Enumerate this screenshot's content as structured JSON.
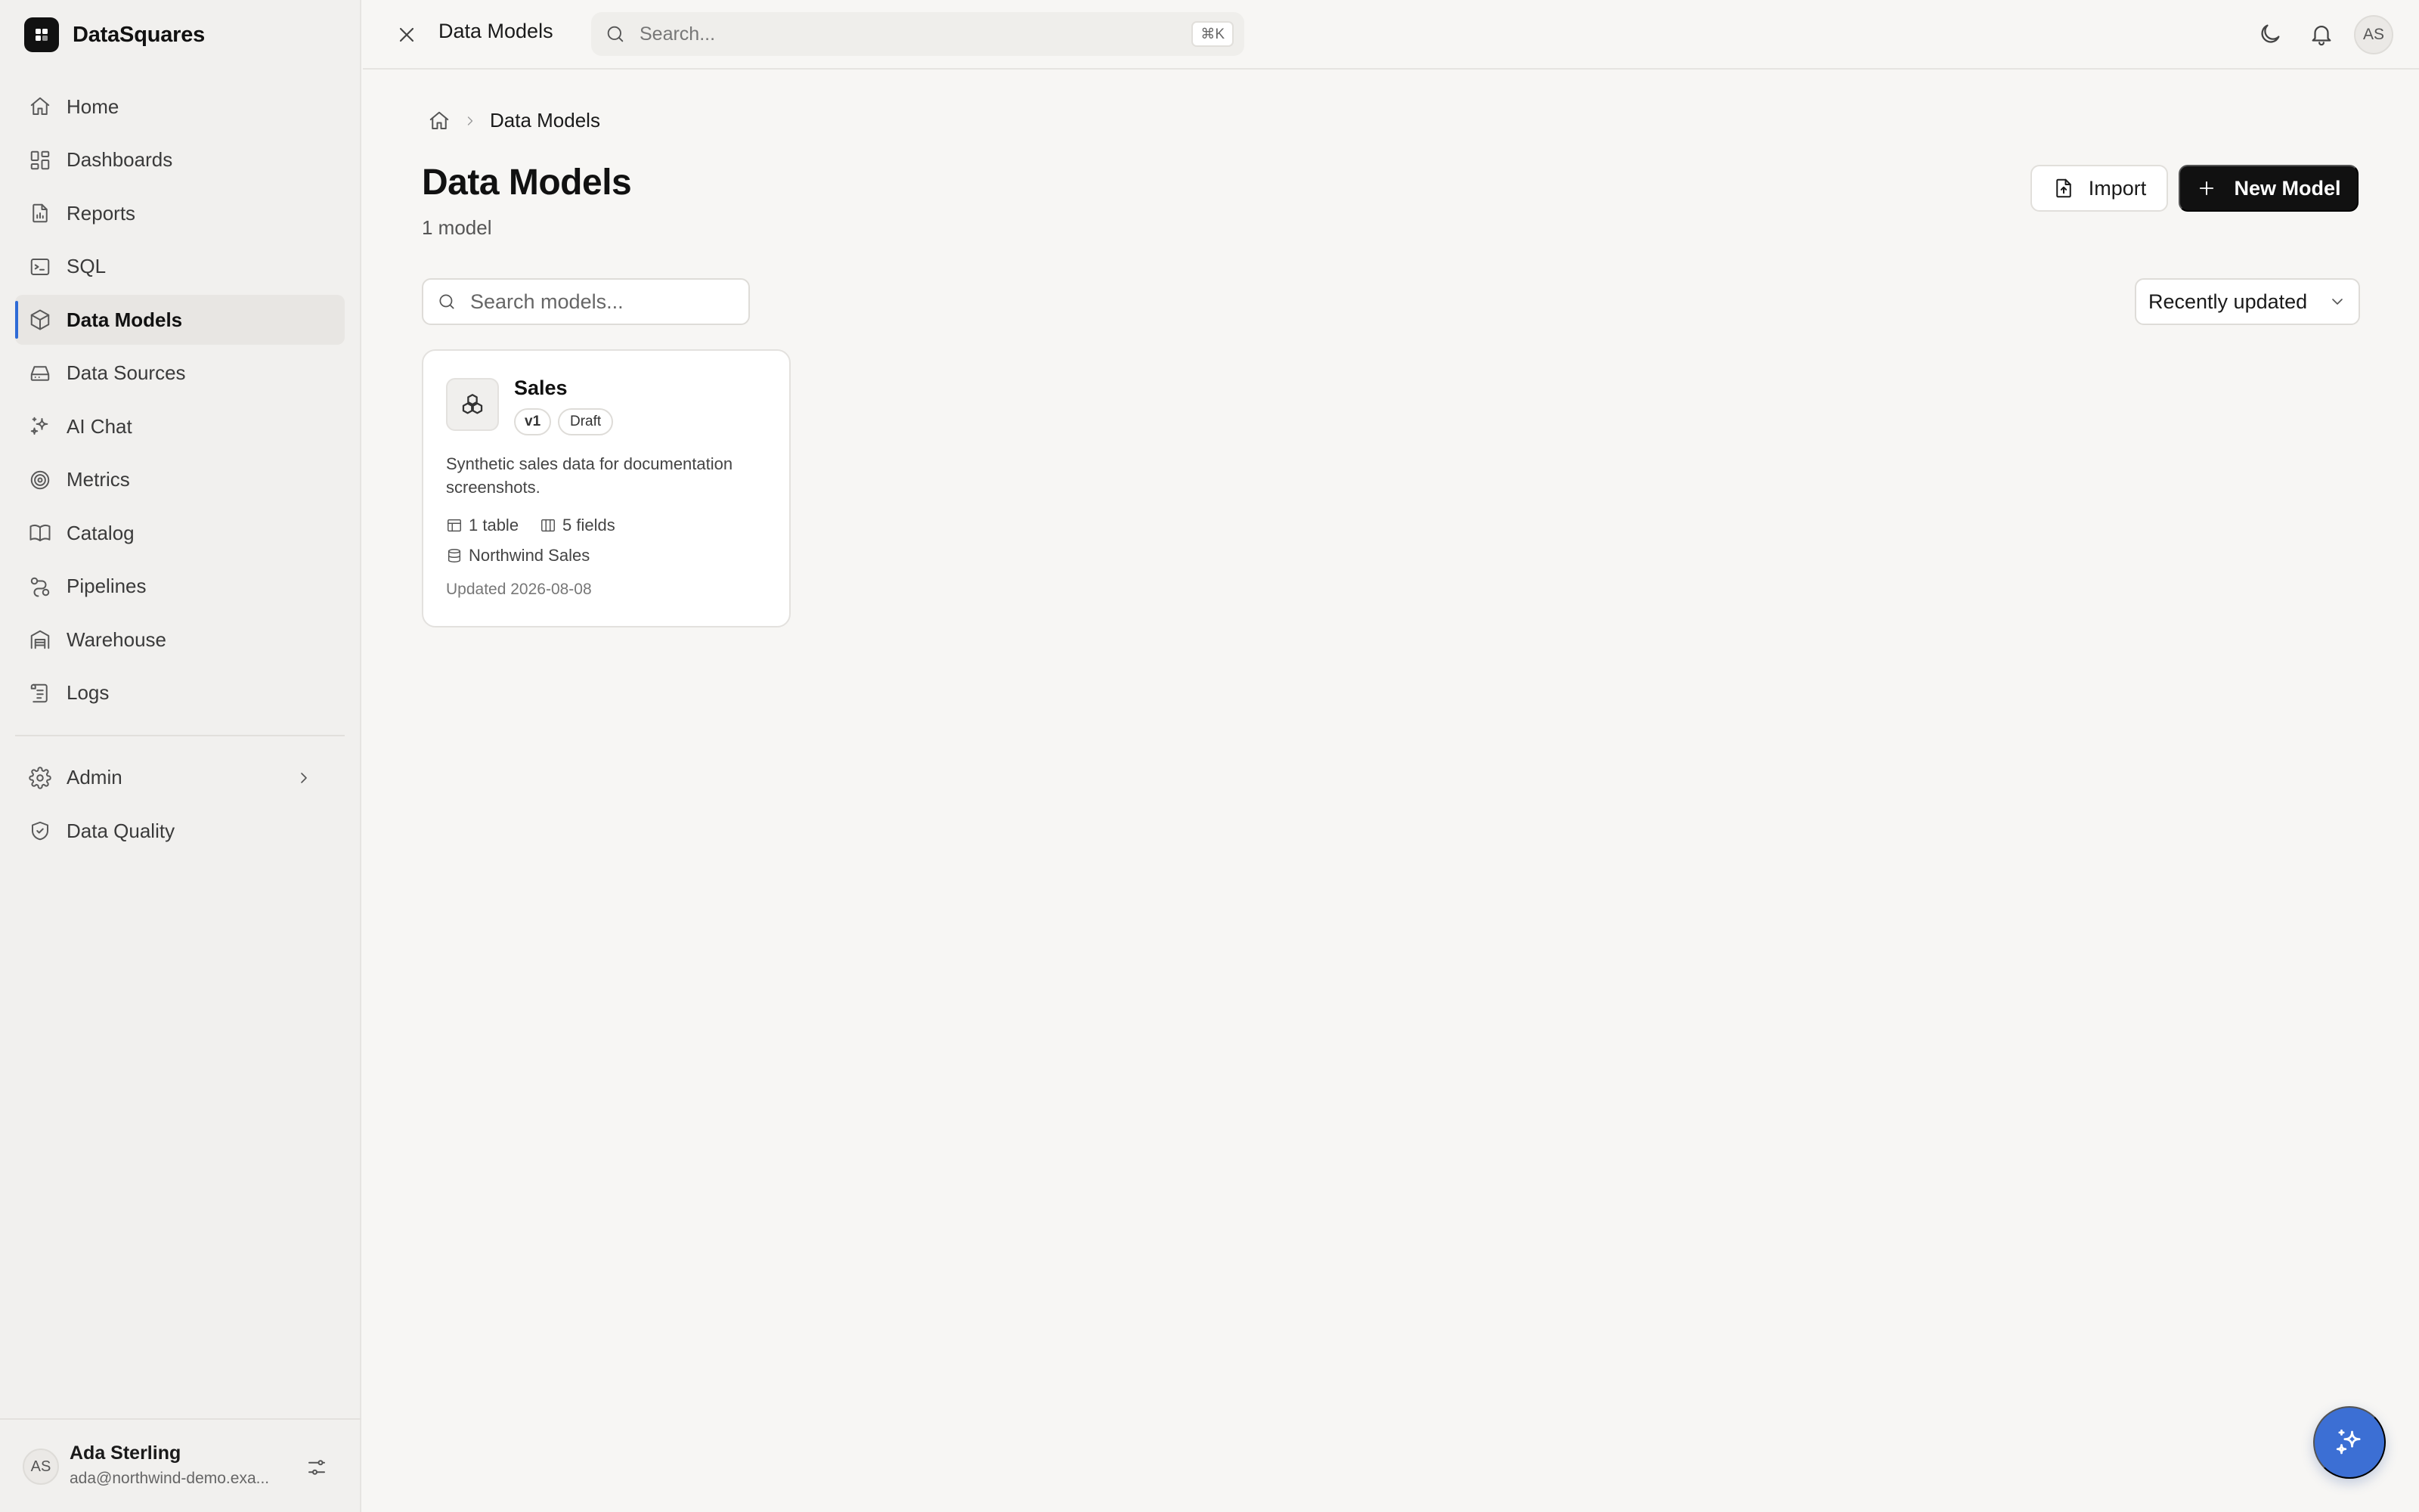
{
  "app": {
    "name": "DataSquares"
  },
  "sidebar": {
    "items": [
      {
        "label": "Home",
        "icon": "home-icon"
      },
      {
        "label": "Dashboards",
        "icon": "dashboard-icon"
      },
      {
        "label": "Reports",
        "icon": "report-icon"
      },
      {
        "label": "SQL",
        "icon": "terminal-icon"
      },
      {
        "label": "Data Models",
        "icon": "cube-icon",
        "active": true
      },
      {
        "label": "Data Sources",
        "icon": "drive-icon"
      },
      {
        "label": "AI Chat",
        "icon": "sparkles-icon"
      },
      {
        "label": "Metrics",
        "icon": "target-icon"
      },
      {
        "label": "Catalog",
        "icon": "book-icon"
      },
      {
        "label": "Pipelines",
        "icon": "pipeline-icon"
      },
      {
        "label": "Warehouse",
        "icon": "warehouse-icon"
      },
      {
        "label": "Logs",
        "icon": "logs-icon"
      }
    ],
    "secondary": [
      {
        "label": "Admin",
        "icon": "gear-icon"
      },
      {
        "label": "Data Quality",
        "icon": "shield-check-icon"
      }
    ],
    "user": {
      "initials": "AS",
      "name": "Ada Sterling",
      "email": "ada@northwind-demo.exa..."
    }
  },
  "topbar": {
    "title": "Data Models",
    "search_placeholder": "Search...",
    "shortcut": "⌘K",
    "avatar_initials": "AS"
  },
  "breadcrumb": {
    "current": "Data Models"
  },
  "page": {
    "title": "Data Models",
    "subtitle": "1 model",
    "import_label": "Import",
    "new_label": "New Model",
    "search_placeholder": "Search models...",
    "sort_value": "Recently updated"
  },
  "models": [
    {
      "name": "Sales",
      "version": "v1",
      "status": "Draft",
      "description": "Synthetic sales data for documentation screenshots.",
      "tables": "1 table",
      "fields": "5 fields",
      "source": "Northwind Sales",
      "updated": "Updated 2026-08-08"
    }
  ],
  "colors": {
    "accent": "#2f6bd6",
    "fab": "#3c6fd4",
    "primary_button": "#111111"
  }
}
